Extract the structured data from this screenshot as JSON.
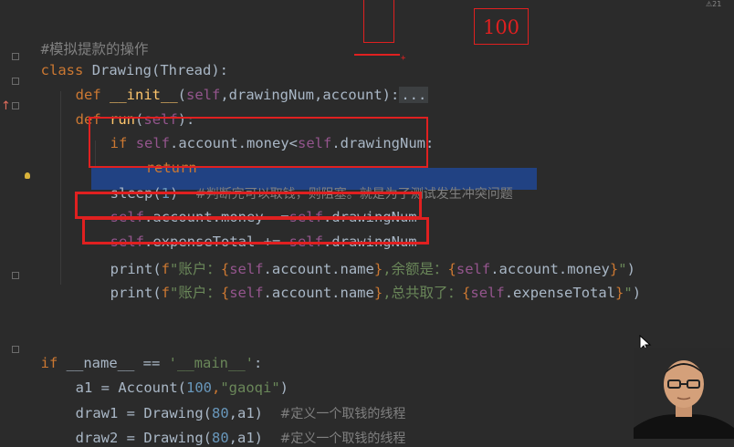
{
  "annotation": {
    "value_box": "100"
  },
  "top_right_badge": "⚠21",
  "code": {
    "comment_title": "#模拟提款的操作",
    "class_kw": "class",
    "class_name": "Drawing",
    "class_base": "(Thread):",
    "def1_kw": "def",
    "def1_name": "__init__",
    "def1_params_open": "(",
    "def1_self": "self",
    "def1_params_rest": ",drawingNum,account):",
    "def1_ellipsis": "...",
    "def2_kw": "def",
    "def2_name": "run",
    "def2_open": "(",
    "def2_self": "self",
    "def2_close": "):",
    "if_kw": "if",
    "if_self1": "self",
    "if_mid": ".account.money<",
    "if_self2": "self",
    "if_end": ".drawingNum:",
    "return_kw": "return",
    "sleep_call": "sleep(",
    "sleep_num": "1",
    "sleep_close": ")",
    "sleep_comment": "#判断完可以取钱，则阻塞。就是为了测试发生冲突问题",
    "l1_self": "self",
    "l1_mid": ".account.money -=",
    "l1_self2": "self",
    "l1_end": ".drawingNum",
    "l2_self": "self",
    "l2_mid": ".expenseTotal += ",
    "l2_self2": "self",
    "l2_end": ".drawingNum",
    "p1_fn": "print(",
    "p1_f": "f",
    "p1_s1": "\"账户：",
    "p1_b1": "{",
    "p1_self": "self",
    "p1_attr": ".account.name",
    "p1_b2": "}",
    "p1_s2": ",余额是：",
    "p1_b3": "{",
    "p1_self2": "self",
    "p1_attr2": ".account.money",
    "p1_b4": "}",
    "p1_s3": "\"",
    "p1_close": ")",
    "p2_fn": "print(",
    "p2_f": "f",
    "p2_s1": "\"账户：",
    "p2_b1": "{",
    "p2_self": "self",
    "p2_attr": ".account.name",
    "p2_b2": "}",
    "p2_s2": ",总共取了：",
    "p2_b3": "{",
    "p2_self2": "self",
    "p2_attr2": ".expenseTotal",
    "p2_b4": "}",
    "p2_s3": "\"",
    "p2_close": ")",
    "main_if": "if",
    "main_name": " __name__ == ",
    "main_str": "'__main__'",
    "main_colon": ":",
    "a1_pre": "a1 = Account(",
    "a1_num": "100",
    "a1_comma": ",",
    "a1_str": "\"gaoqi\"",
    "a1_close": ")",
    "d1_pre": "draw1 = Drawing(",
    "d1_num": "80",
    "d1_rest": ",a1)",
    "d1_comment": "#定义一个取钱的线程",
    "d2_pre": "draw2 = Drawing(",
    "d2_num": "80",
    "d2_rest": ",a1)",
    "d2_comment": "#定义一个取钱的线程"
  }
}
